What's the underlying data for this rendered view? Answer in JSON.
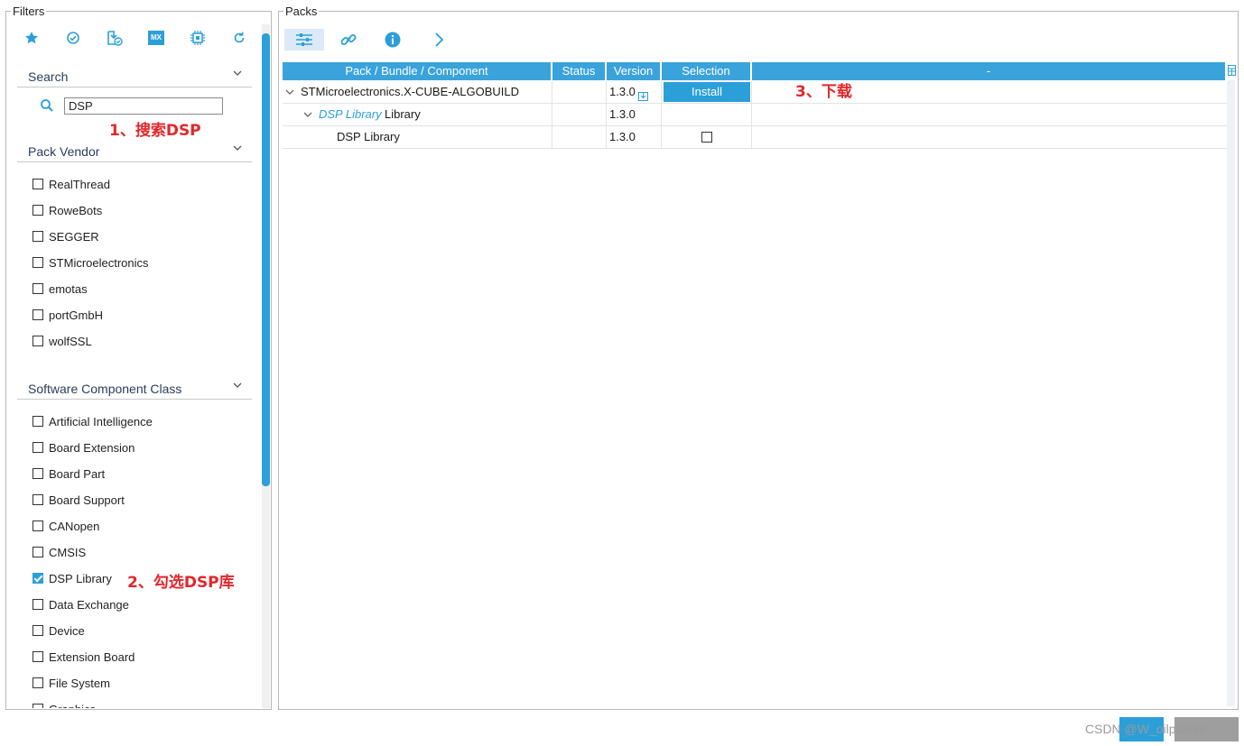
{
  "filters": {
    "legend": "Filters",
    "toolbar_icons": [
      "star-icon",
      "check-circle-icon",
      "download-check-icon",
      "mx-icon",
      "chip-icon",
      "refresh-icon"
    ],
    "mx_label": "MX",
    "search": {
      "title": "Search",
      "value": "DSP"
    },
    "pack_vendor": {
      "title": "Pack Vendor",
      "items": [
        "RealThread",
        "RoweBots",
        "SEGGER",
        "STMicroelectronics",
        "emotas",
        "portGmbH",
        "wolfSSL"
      ]
    },
    "component_class": {
      "title": "Software Component Class",
      "items": [
        {
          "label": "Artificial Intelligence",
          "checked": false
        },
        {
          "label": "Board Extension",
          "checked": false
        },
        {
          "label": "Board Part",
          "checked": false
        },
        {
          "label": "Board Support",
          "checked": false
        },
        {
          "label": "CANopen",
          "checked": false
        },
        {
          "label": "CMSIS",
          "checked": false
        },
        {
          "label": "DSP Library",
          "checked": true
        },
        {
          "label": "Data Exchange",
          "checked": false
        },
        {
          "label": "Device",
          "checked": false
        },
        {
          "label": "Extension Board",
          "checked": false
        },
        {
          "label": "File System",
          "checked": false
        },
        {
          "label": "Graphics",
          "checked": false
        }
      ]
    }
  },
  "packs": {
    "legend": "Packs",
    "toolbar_icons": [
      "filter-settings-icon",
      "link-icon",
      "info-icon",
      "chevron-right-icon"
    ],
    "columns": [
      "Pack / Bundle / Component",
      "Status",
      "Version",
      "Selection",
      "-"
    ],
    "rows": [
      {
        "name": "STMicroelectronics.X-CUBE-ALGOBUILD",
        "version": "1.3.0",
        "selection": "Install"
      },
      {
        "name_italic": "DSP Library",
        "name_suffix": " Library",
        "version": "1.3.0"
      },
      {
        "name": "DSP Library",
        "version": "1.3.0"
      }
    ]
  },
  "annotations": {
    "step1": "1、搜索DSP",
    "step2": "2、勾选DSP库",
    "step3": "3、下载"
  },
  "bottom": {
    "watermark": "CSDN @W_oilpicture"
  },
  "colors": {
    "accent": "#2b9fd8",
    "annotation": "#e3262b"
  }
}
